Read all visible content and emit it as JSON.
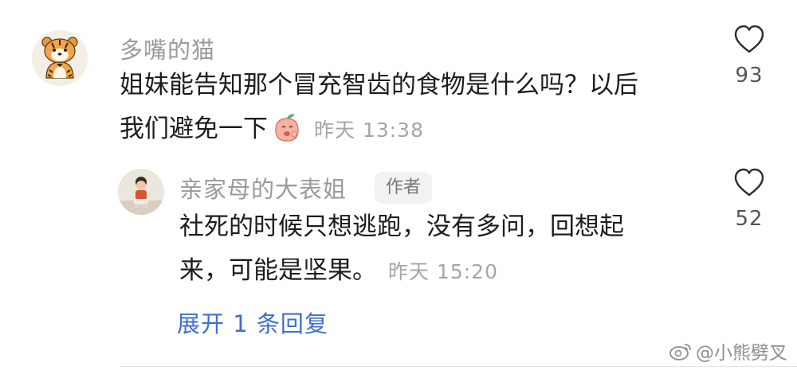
{
  "comment": {
    "username": "多嘴的猫",
    "text_line1": "姐妹能告知那个冒充智齿的食物是什么吗？以后",
    "text_line2": "我们避免一下",
    "time": "昨天 13:38",
    "likes": "93",
    "avatar_icon": "tiger-avatar-icon",
    "emoji_icon": "peach-emoji-icon"
  },
  "reply": {
    "username": "亲家母的大表姐",
    "badge": "作者",
    "text_line1": "社死的时候只想逃跑，没有多问，回想起",
    "text_line2": "来，可能是坚果。",
    "time": "昨天 15:20",
    "likes": "52",
    "avatar_icon": "child-photo-avatar"
  },
  "expand_label": "展开 1 条回复",
  "watermark": "@小熊劈叉",
  "colors": {
    "username": "#9a9a9a",
    "time": "#a5a5a5",
    "link": "#3d6fd0",
    "text": "#1d1d1d"
  }
}
